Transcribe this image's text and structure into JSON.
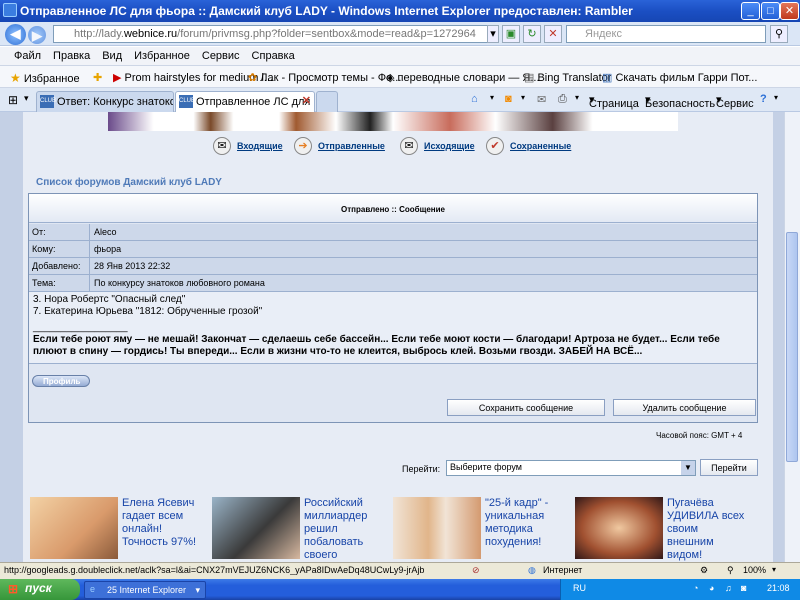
{
  "window": {
    "title": "Отправленное ЛС для фьора :: Дамский клуб LADY - Windows Internet Explorer предоставлен: Rambler",
    "minimize": "_",
    "maximize": "□",
    "close": "✕"
  },
  "address": {
    "url_prefix": "http://lady.",
    "url_domain": "webnice.ru",
    "url_rest": "/forum/privmsg.php?folder=sentbox&mode=read&p=1272964",
    "search_placeholder": "Яндекс"
  },
  "menu": [
    "Файл",
    "Правка",
    "Вид",
    "Избранное",
    "Сервис",
    "Справка"
  ],
  "favorites": {
    "label": "Избранное",
    "items": [
      "Prom hairstyles for medium l...",
      "Лак - Просмотр темы - Фо...",
      "переводные словари — Я...",
      "Bing Translator",
      "Скачать фильм Гарри Пот..."
    ]
  },
  "tabs": [
    {
      "label": "Ответ: Конкурс знатоков л...",
      "icon": "CLUB"
    },
    {
      "label": "Отправленное ЛС для ...",
      "icon": "CLUB"
    }
  ],
  "commandbar": {
    "page": "Страница",
    "security": "Безопасность",
    "tools": "Сервис"
  },
  "pm_nav": [
    {
      "label": "Входящие",
      "icon": "inbox-icon"
    },
    {
      "label": "Отправленные",
      "icon": "arrow-icon"
    },
    {
      "label": "Исходящие",
      "icon": "outbox-icon"
    },
    {
      "label": "Сохраненные",
      "icon": "saved-icon"
    }
  ],
  "forum_index_link": "Список форумов Дамский клуб LADY",
  "message": {
    "header": "Отправлено :: Сообщение",
    "fields": [
      {
        "label": "От:",
        "value": "Aleco"
      },
      {
        "label": "Кому:",
        "value": "фьора"
      },
      {
        "label": "Добавлено:",
        "value": "28 Янв 2013 22:32"
      },
      {
        "label": "Тема:",
        "value": "По конкурсу знатоков любовного романа"
      }
    ],
    "body_lines": [
      "3. Нора Робертс \"Опасный след\"",
      "7. Екатерина Юрьева \"1812: Обрученные грозой\""
    ],
    "separator": "_________________",
    "signature": "Если тебе роют яму — не мешай! Закончат — сделаешь себе бассейн... Если тебе моют кости — благодари! Артроза не будет... Если тебе плюют в спину — гордись! Ты впереди... Если в жизни что-то не клеится, выбрось клей. Возьми гвозди. ЗАБЕЙ НА ВСЁ...",
    "profile_button": "Профиль",
    "save_button": "Сохранить сообщение",
    "delete_button": "Удалить сообщение"
  },
  "timezone": "Часовой пояс: GMT + 4",
  "jump": {
    "label": "Перейти:",
    "selected": "Выберите форум",
    "go": "Перейти"
  },
  "ads": [
    {
      "text": "Елена Ясевич гадает всем онлайн! Точность 97%!"
    },
    {
      "text": "Российский миллиардер решил побаловать своего"
    },
    {
      "text": "\"25-й кадр\" - уникальная методика похудения!"
    },
    {
      "text": "Пугачёва УДИВИЛА всех своим внешним видом!"
    }
  ],
  "statusbar": {
    "url": "http://googleads.g.doubleclick.net/aclk?sa=l&ai=CNX27mVEJUZ6NCK6_yAPa8IDwAeDq48UCwLy9-jrAjbcBEAE",
    "zone": "Интернет",
    "zoom": "100%"
  },
  "taskbar": {
    "start": "пуск",
    "task": "25 Internet Explorer",
    "lang": "RU",
    "clock": "21:08"
  }
}
